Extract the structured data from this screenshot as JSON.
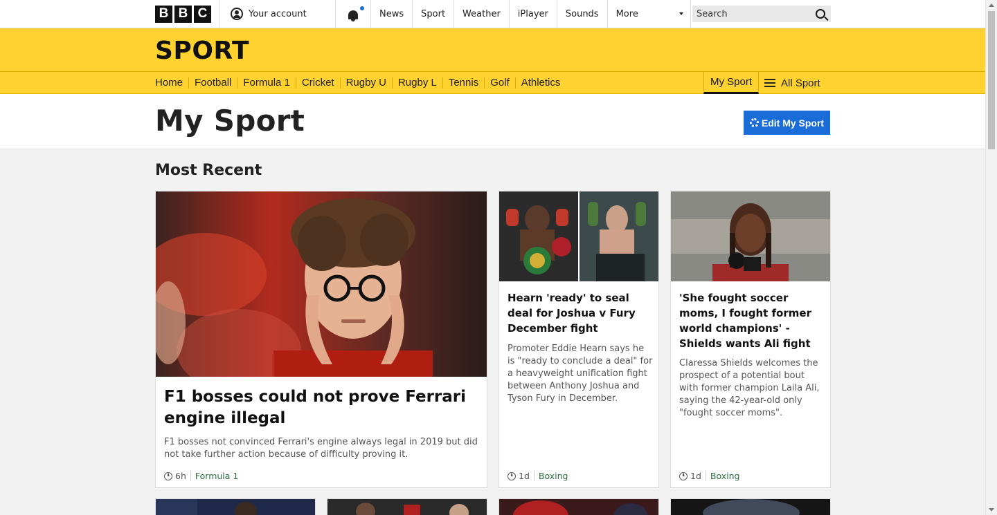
{
  "global_nav": {
    "logo_letters": [
      "B",
      "B",
      "C"
    ],
    "account_label": "Your account",
    "links": [
      "News",
      "Sport",
      "Weather",
      "iPlayer",
      "Sounds"
    ],
    "more_label": "More",
    "search_placeholder": "Search"
  },
  "sport_header": {
    "title": "SPORT",
    "nav": [
      "Home",
      "Football",
      "Formula 1",
      "Cricket",
      "Rugby U",
      "Rugby L",
      "Tennis",
      "Golf",
      "Athletics"
    ],
    "my_sport_tab": "My Sport",
    "all_sport_label": "All Sport"
  },
  "page": {
    "title": "My Sport",
    "edit_button": "Edit My Sport",
    "section_title": "Most Recent"
  },
  "stories": [
    {
      "headline": "F1 bosses could not prove Ferrari engine illegal",
      "summary": "F1 bosses not convinced Ferrari's engine always legal in 2019 but did not take further action because of difficulty proving it.",
      "time": "6h",
      "tag": "Formula 1"
    },
    {
      "headline": "Hearn 'ready' to seal deal for Joshua v Fury December fight",
      "summary": "Promoter Eddie Hearn says he is \"ready to conclude a deal\" for a heavyweight unification fight between Anthony Joshua and Tyson Fury in December.",
      "time": "1d",
      "tag": "Boxing"
    },
    {
      "headline": "'She fought soccer moms, I fought former world champions' - Shields wants Ali fight",
      "summary": "Claressa Shields welcomes the prospect of a potential bout with former champion Laila Ali, saying the 42-year-old only \"fought soccer moms\".",
      "time": "1d",
      "tag": "Boxing"
    }
  ],
  "colors": {
    "sport_yellow": "#ffd230",
    "edit_blue": "#1a6dd9",
    "tag_green": "#2d6e3e"
  }
}
